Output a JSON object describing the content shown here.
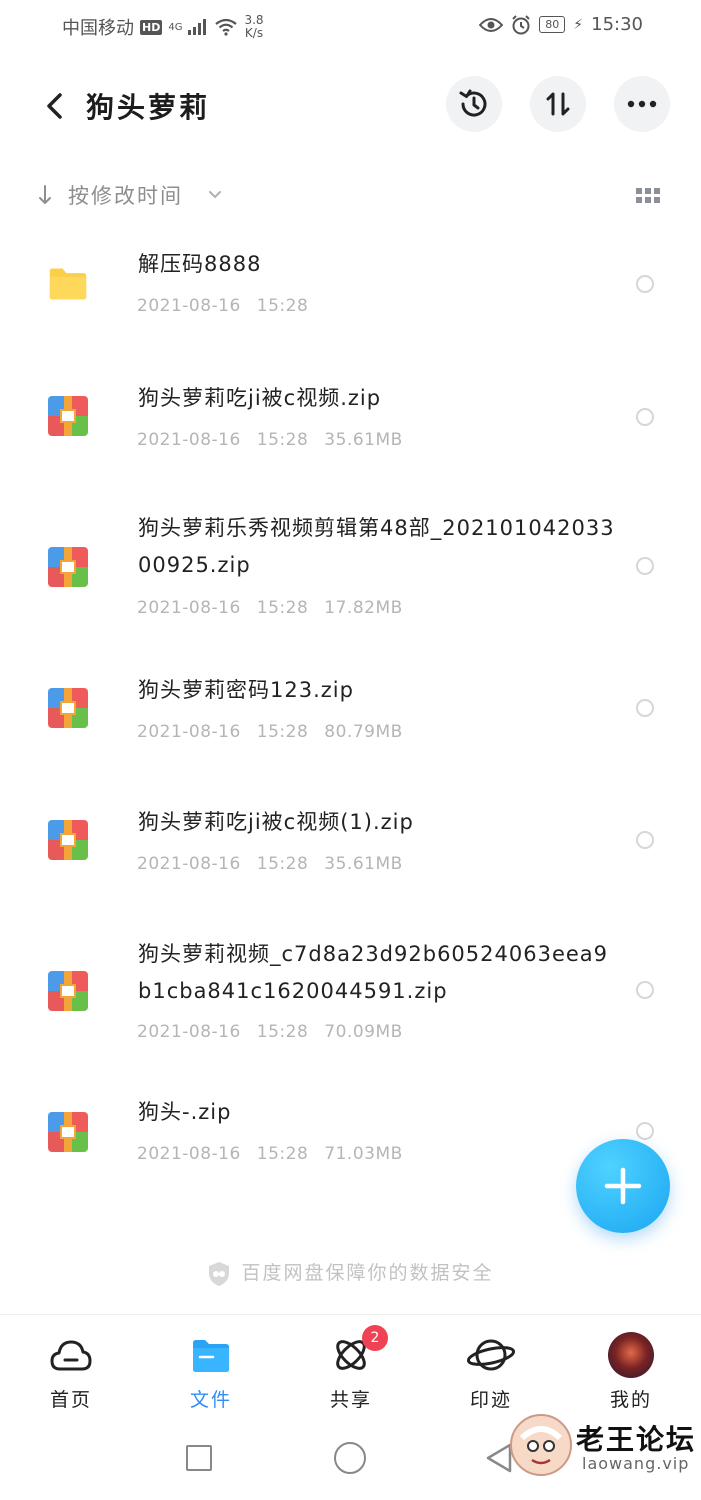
{
  "status_bar": {
    "carrier": "中国移动",
    "hd": "HD",
    "network": "4G",
    "speed_value": "3.8",
    "speed_unit": "K/s",
    "battery": "80",
    "time": "15:30"
  },
  "header": {
    "title": "狗头萝莉",
    "icons": [
      "back-icon",
      "history-icon",
      "sort-order-icon",
      "more-icon"
    ]
  },
  "sort": {
    "label": "按修改时间"
  },
  "files": [
    {
      "name": "解压码8888",
      "date": "2021-08-16",
      "time": "15:28",
      "size": "",
      "type": "folder"
    },
    {
      "name": "狗头萝莉吃ji被c视频.zip",
      "date": "2021-08-16",
      "time": "15:28",
      "size": "35.61MB",
      "type": "zip"
    },
    {
      "name": "狗头萝莉乐秀视频剪辑第48部_20210104203300925.zip",
      "date": "2021-08-16",
      "time": "15:28",
      "size": "17.82MB",
      "type": "zip"
    },
    {
      "name": "狗头萝莉密码123.zip",
      "date": "2021-08-16",
      "time": "15:28",
      "size": "80.79MB",
      "type": "zip"
    },
    {
      "name": "狗头萝莉吃ji被c视频(1).zip",
      "date": "2021-08-16",
      "time": "15:28",
      "size": "35.61MB",
      "type": "zip"
    },
    {
      "name": "狗头萝莉视频_c7d8a23d92b60524063eea9b1cba841c1620044591.zip",
      "date": "2021-08-16",
      "time": "15:28",
      "size": "70.09MB",
      "type": "zip"
    },
    {
      "name": "狗头-.zip",
      "date": "2021-08-16",
      "time": "15:28",
      "size": "71.03MB",
      "type": "zip"
    }
  ],
  "footer_note": "百度网盘保障你的数据安全",
  "bottom_nav": {
    "items": [
      {
        "label": "首页",
        "icon": "cloud-icon"
      },
      {
        "label": "文件",
        "icon": "folder-icon"
      },
      {
        "label": "共享",
        "icon": "atom-icon",
        "badge": "2"
      },
      {
        "label": "印迹",
        "icon": "planet-icon"
      },
      {
        "label": "我的",
        "icon": "avatar"
      }
    ],
    "active": "文件"
  },
  "watermark": {
    "title": "老王论坛",
    "url": "laowang.vip"
  },
  "colors": {
    "accent": "#2f8df5",
    "fab": "#1aa6f2",
    "badge": "#ef4355",
    "folder": "#fbcf47"
  }
}
